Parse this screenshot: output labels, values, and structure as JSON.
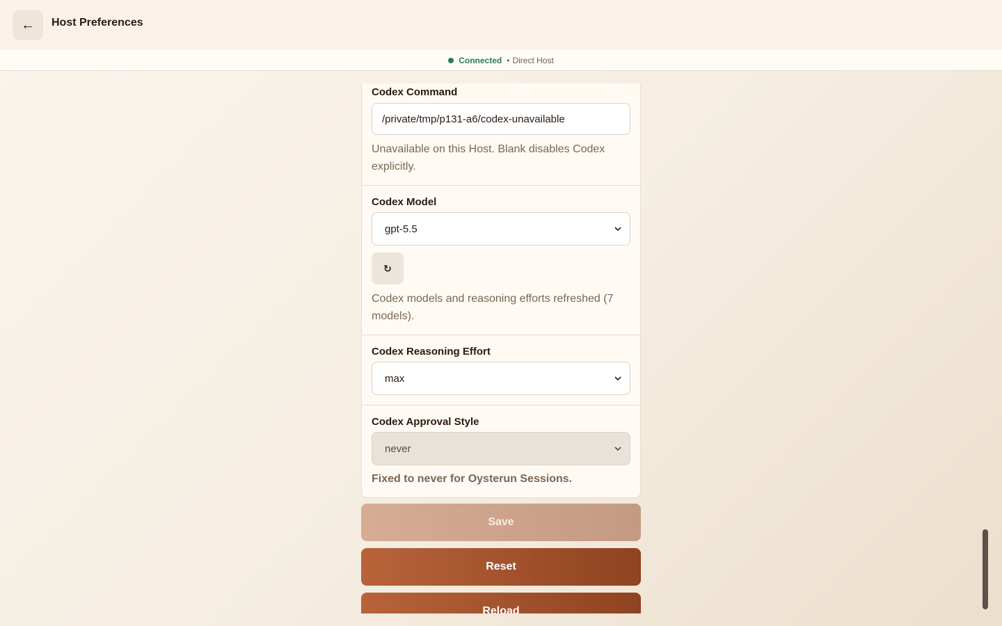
{
  "header": {
    "back_icon": "←",
    "title": "Host Preferences"
  },
  "status": {
    "connected_label": "Connected",
    "separator": "•",
    "host_label": "Direct Host",
    "connected_color": "#2d7a55"
  },
  "codex_command": {
    "label": "Codex Command",
    "value": "/private/tmp/p131-a6/codex-unavailable",
    "help": "Unavailable on this Host. Blank disables Codex explicitly."
  },
  "codex_model": {
    "label": "Codex Model",
    "selected": "gpt-5.5",
    "refresh_icon": "↻",
    "help": "Codex models and reasoning efforts refreshed (7 models)."
  },
  "codex_reasoning": {
    "label": "Codex Reasoning Effort",
    "selected": "max"
  },
  "codex_approval": {
    "label": "Codex Approval Style",
    "selected": "never",
    "help": "Fixed to never for Oysterun Sessions."
  },
  "actions": {
    "save_label": "Save",
    "reset_label": "Reset",
    "reload_label": "Reload"
  },
  "colors": {
    "accent": "#a4532b",
    "accent_disabled": "#d0a58d",
    "background": "#f5ede1"
  }
}
